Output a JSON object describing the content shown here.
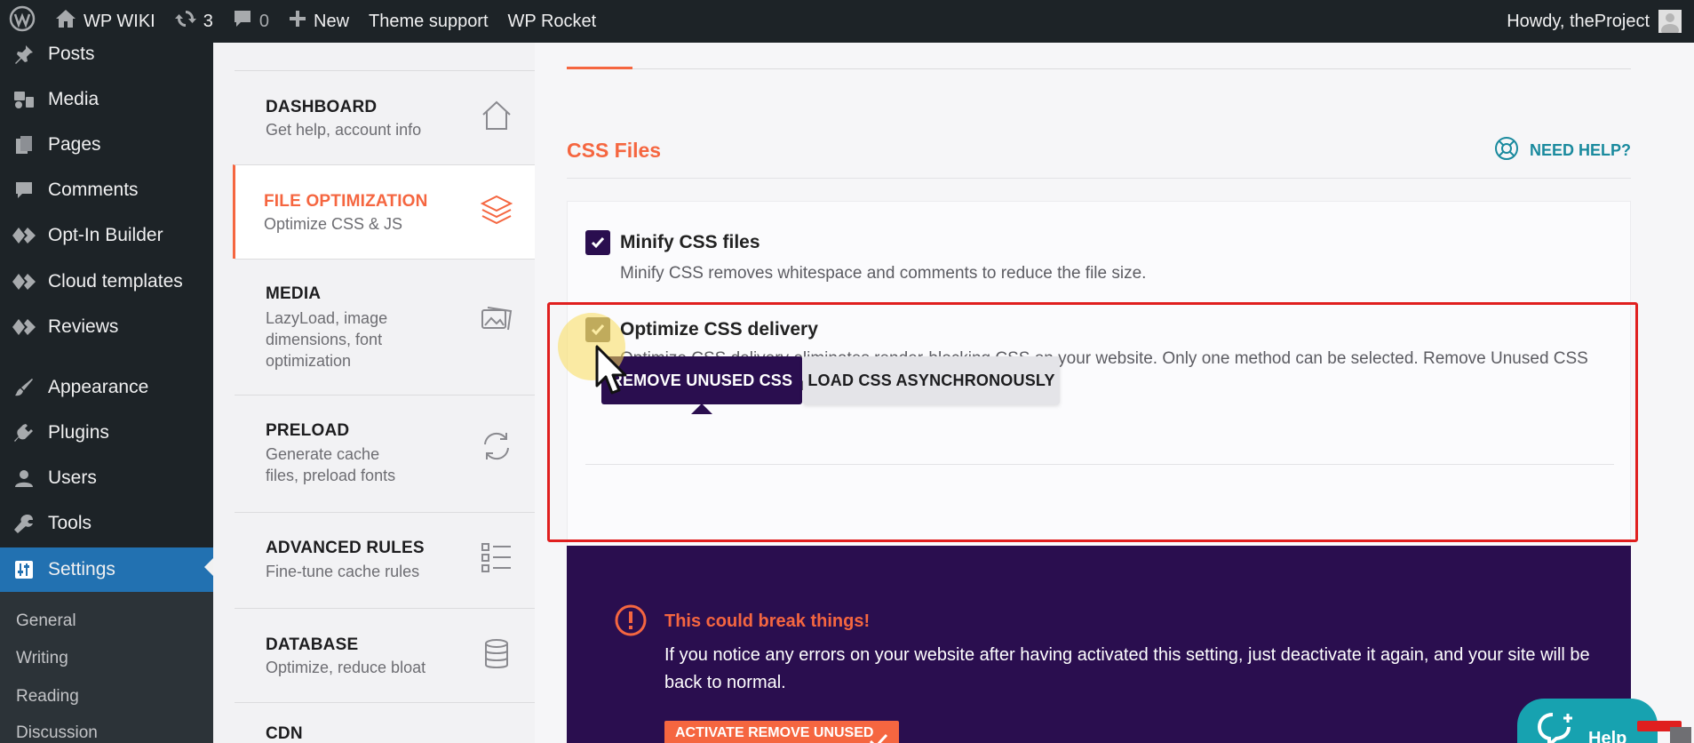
{
  "admin_bar": {
    "wp_logo_icon": "wordpress-logo-icon",
    "site_name": "WP WIKI",
    "updates_count": "3",
    "comments_count": "0",
    "new_label": "New",
    "theme_support_label": "Theme support",
    "wp_rocket_label": "WP Rocket",
    "greeting": "Howdy, theProject"
  },
  "admin_menu": {
    "items": [
      {
        "label": "Posts",
        "icon": "pin-icon"
      },
      {
        "label": "Media",
        "icon": "media-icon"
      },
      {
        "label": "Pages",
        "icon": "pages-icon"
      },
      {
        "label": "Comments",
        "icon": "comment-icon"
      },
      {
        "label": "Opt-In Builder",
        "icon": "diamond-icon"
      },
      {
        "label": "Cloud templates",
        "icon": "diamond-icon"
      },
      {
        "label": "Reviews",
        "icon": "diamond-icon"
      },
      {
        "label": "Appearance",
        "icon": "brush-icon"
      },
      {
        "label": "Plugins",
        "icon": "plug-icon"
      },
      {
        "label": "Users",
        "icon": "user-icon"
      },
      {
        "label": "Tools",
        "icon": "wrench-icon"
      },
      {
        "label": "Settings",
        "icon": "sliders-icon",
        "active": true
      }
    ],
    "submenu": [
      "General",
      "Writing",
      "Reading",
      "Discussion"
    ]
  },
  "rocket_nav": {
    "items": [
      {
        "title": "DASHBOARD",
        "desc": "Get help, account info",
        "icon": "home-icon"
      },
      {
        "title": "FILE OPTIMIZATION",
        "desc": "Optimize CSS & JS",
        "icon": "layers-icon",
        "active": true
      },
      {
        "title": "MEDIA",
        "desc": "LazyLoad, image dimensions, font optimization",
        "icon": "images-icon"
      },
      {
        "title": "PRELOAD",
        "desc": "Generate cache files, preload fonts",
        "icon": "refresh-icon"
      },
      {
        "title": "ADVANCED RULES",
        "desc": "Fine-tune cache rules",
        "icon": "checklist-icon"
      },
      {
        "title": "DATABASE",
        "desc": "Optimize, reduce bloat",
        "icon": "database-icon"
      },
      {
        "title": "CDN",
        "desc": "",
        "icon": "cdn-icon"
      }
    ]
  },
  "main": {
    "section_title": "CSS Files",
    "help_label": "NEED HELP?",
    "minify": {
      "label": "Minify CSS files",
      "desc": "Minify CSS removes whitespace and comments to reduce the file size.",
      "checked": true
    },
    "optimize": {
      "label": "Optimize CSS delivery",
      "desc": "Optimize CSS delivery eliminates render-blocking CSS on your website. Only one method can be selected. Remove Unused CSS is recommended for optimal performance.",
      "checked": true
    },
    "methods": {
      "remove_unused": "REMOVE UNUSED CSS",
      "load_async": "LOAD CSS ASYNCHRONOUSLY"
    },
    "warning": {
      "title": "This could break things!",
      "text": "If you notice any errors on your website after having activated this setting, just deactivate it again, and your site will be back to normal.",
      "button": "ACTIVATE REMOVE UNUSED CSS"
    }
  },
  "help_widget": {
    "label": "Help"
  },
  "colors": {
    "accent": "#f56640",
    "dark_purple": "#2a0e4f",
    "wp_blue": "#2271b1",
    "admin_dark": "#1d2327",
    "teal": "#1a8a9e",
    "highlight_red": "#e01f1f"
  }
}
